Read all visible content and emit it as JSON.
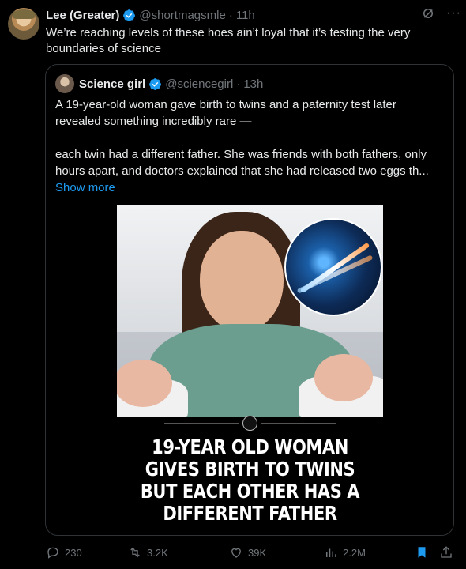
{
  "tweet": {
    "author_name": "Lee (Greater)",
    "author_handle": "@shortmagsmle",
    "time": "11h",
    "text": "We’re reaching levels of these hoes ain’t loyal that it’s testing the very boundaries of science"
  },
  "quote": {
    "author_name": "Science girl",
    "author_handle": "@sciencegirl",
    "time": "13h",
    "paragraph1": "A 19-year-old woman gave birth to twins and a paternity test later revealed something incredibly rare —",
    "paragraph2": "each twin had a different father. She was friends with both fathers, only hours apart, and doctors explained that she had released two eggs th...",
    "show_more": "Show more",
    "media_headline": "19-YEAR OLD WOMAN GIVES BIRTH TO TWINS BUT EACH OTHER HAS A DIFFERENT FATHER"
  },
  "actions": {
    "replies": "230",
    "retweets": "3.2K",
    "likes": "39K",
    "views": "2.2M"
  },
  "icons": {
    "verified": "verified-badge-icon",
    "grok": "grok-icon",
    "more": "more-icon",
    "reply": "reply-icon",
    "retweet": "retweet-icon",
    "like": "heart-icon",
    "views": "views-icon",
    "bookmark": "bookmark-icon",
    "share": "share-icon"
  },
  "colors": {
    "background": "#000000",
    "text": "#e7e9ea",
    "muted": "#71767b",
    "accent": "#1d9bf0",
    "border": "#2f3336"
  }
}
